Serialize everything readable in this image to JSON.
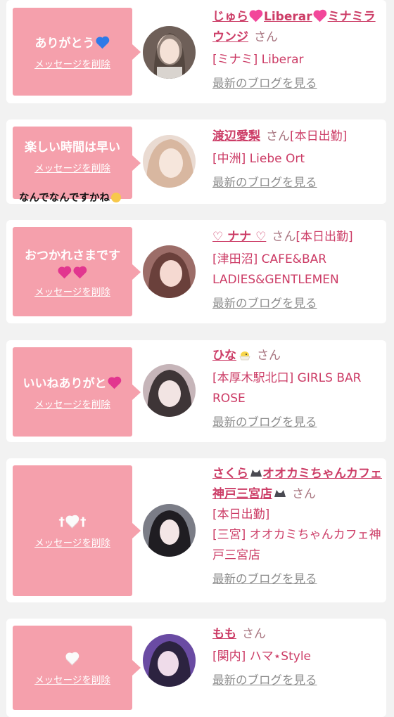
{
  "colors": {
    "card_bubble": "#f5a0ac",
    "name_text": "#cc3c66",
    "suffix_text": "#a87580",
    "link_text": "#8c8c8c"
  },
  "delete_label": "メッセージを削除",
  "blog_label": "最新のブログを見る",
  "cards": [
    {
      "message": "ありがとう",
      "message_icon": "blue-heart-icon",
      "extra": "",
      "name_parts": [
        "じゅら",
        "Liberar",
        "ミナミラウンジ"
      ],
      "name_icons": [
        "pink-heart-icon",
        "pink-heart-icon"
      ],
      "suffix": "さん",
      "status": "",
      "shop": "[ミナミ] Liberar",
      "avatar": "avatar-photo"
    },
    {
      "message": "楽しい時間は早い",
      "message_icon": "",
      "extra": "なんでなんですかね",
      "extra_icon": "pleading-face-icon",
      "name": "渡辺愛梨",
      "suffix": "さん",
      "status": "[本日出勤]",
      "shop": "[中洲] Liebe Ort",
      "avatar": "avatar-photo"
    },
    {
      "message": "おつかれさまです",
      "message_icon": "two-hearts-icon",
      "extra": "",
      "name": "♡ ナナ ♡",
      "suffix": "さん",
      "status": "[本日出勤]",
      "shop": "[津田沼] CAFE&BAR LADIES&GENTLEMEN",
      "avatar": "avatar-photo"
    },
    {
      "message": "いいねありがと",
      "message_icon": "heart-with-ribbon-icon",
      "extra": "",
      "name": "ひな",
      "name_icon": "hatching-chick-icon",
      "suffix": "さん",
      "status": "",
      "shop": "[本厚木駅北口] GIRLS BAR ROSE",
      "avatar": "avatar-photo"
    },
    {
      "message": "†",
      "message_b": "†",
      "message_icon": "heart-decoration-icon",
      "extra": "",
      "name_a": "さくら",
      "name_b": "オオカミちゃんカフェ神戸三宮店",
      "name_icons": [
        "wolf-icon",
        "wolf-icon"
      ],
      "suffix": "さん",
      "status": "[本日出勤]",
      "shop": "[三宮] オオカミちゃんカフェ神戸三宮店",
      "avatar": "avatar-photo"
    },
    {
      "message": "",
      "message_icon": "white-heart-icon",
      "extra": "",
      "name": "もも",
      "suffix": "さん",
      "status": "",
      "shop": "[関内] ハマ⋆Style",
      "avatar": "avatar-photo"
    }
  ]
}
